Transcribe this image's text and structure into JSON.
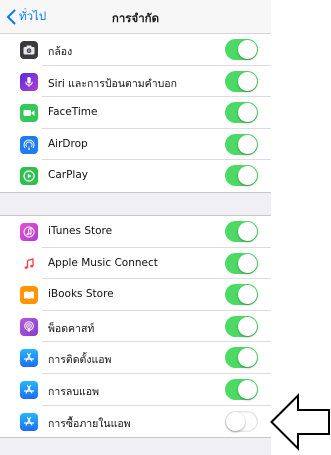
{
  "nav": {
    "back_label": "ทั่วไป",
    "title": "การจำกัด"
  },
  "groups": [
    {
      "rows": [
        {
          "label": "กล้อง",
          "icon": "camera-icon",
          "icon_bg": "#3a3a3c",
          "enabled": true
        },
        {
          "label": "Siri และการป้อนตามคำบอก",
          "icon": "siri-mic-icon",
          "icon_bg": "#8a2be2",
          "enabled": true
        },
        {
          "label": "FaceTime",
          "icon": "facetime-icon",
          "icon_bg": "#34c759",
          "enabled": true
        },
        {
          "label": "AirDrop",
          "icon": "airdrop-icon",
          "icon_bg": "#1e7cf2",
          "enabled": true
        },
        {
          "label": "CarPlay",
          "icon": "carplay-icon",
          "icon_bg": "#2fbf4f",
          "enabled": true
        }
      ]
    },
    {
      "rows": [
        {
          "label": "iTunes Store",
          "icon": "itunes-store-icon",
          "icon_bg": "#d63fcf",
          "enabled": true
        },
        {
          "label": "Apple Music Connect",
          "icon": "music-note-icon",
          "icon_bg": "#ffffff",
          "enabled": true
        },
        {
          "label": "iBooks Store",
          "icon": "ibooks-icon",
          "icon_bg": "#ff9500",
          "enabled": true
        },
        {
          "label": "พ็อดคาสท์",
          "icon": "podcasts-icon",
          "icon_bg": "#9b4dca",
          "enabled": true
        },
        {
          "label": "การติดตั้งแอพ",
          "icon": "app-store-icon",
          "icon_bg": "#1d8cf8",
          "enabled": true
        },
        {
          "label": "การลบแอพ",
          "icon": "app-store-icon",
          "icon_bg": "#1d8cf8",
          "enabled": true
        },
        {
          "label": "การซื้อภายในแอพ",
          "icon": "app-store-icon",
          "icon_bg": "#1d8cf8",
          "enabled": false
        }
      ]
    }
  ],
  "colors": {
    "accent": "#007aff",
    "toggle_on": "#4cd964",
    "annotation_arrow": "#000000"
  }
}
